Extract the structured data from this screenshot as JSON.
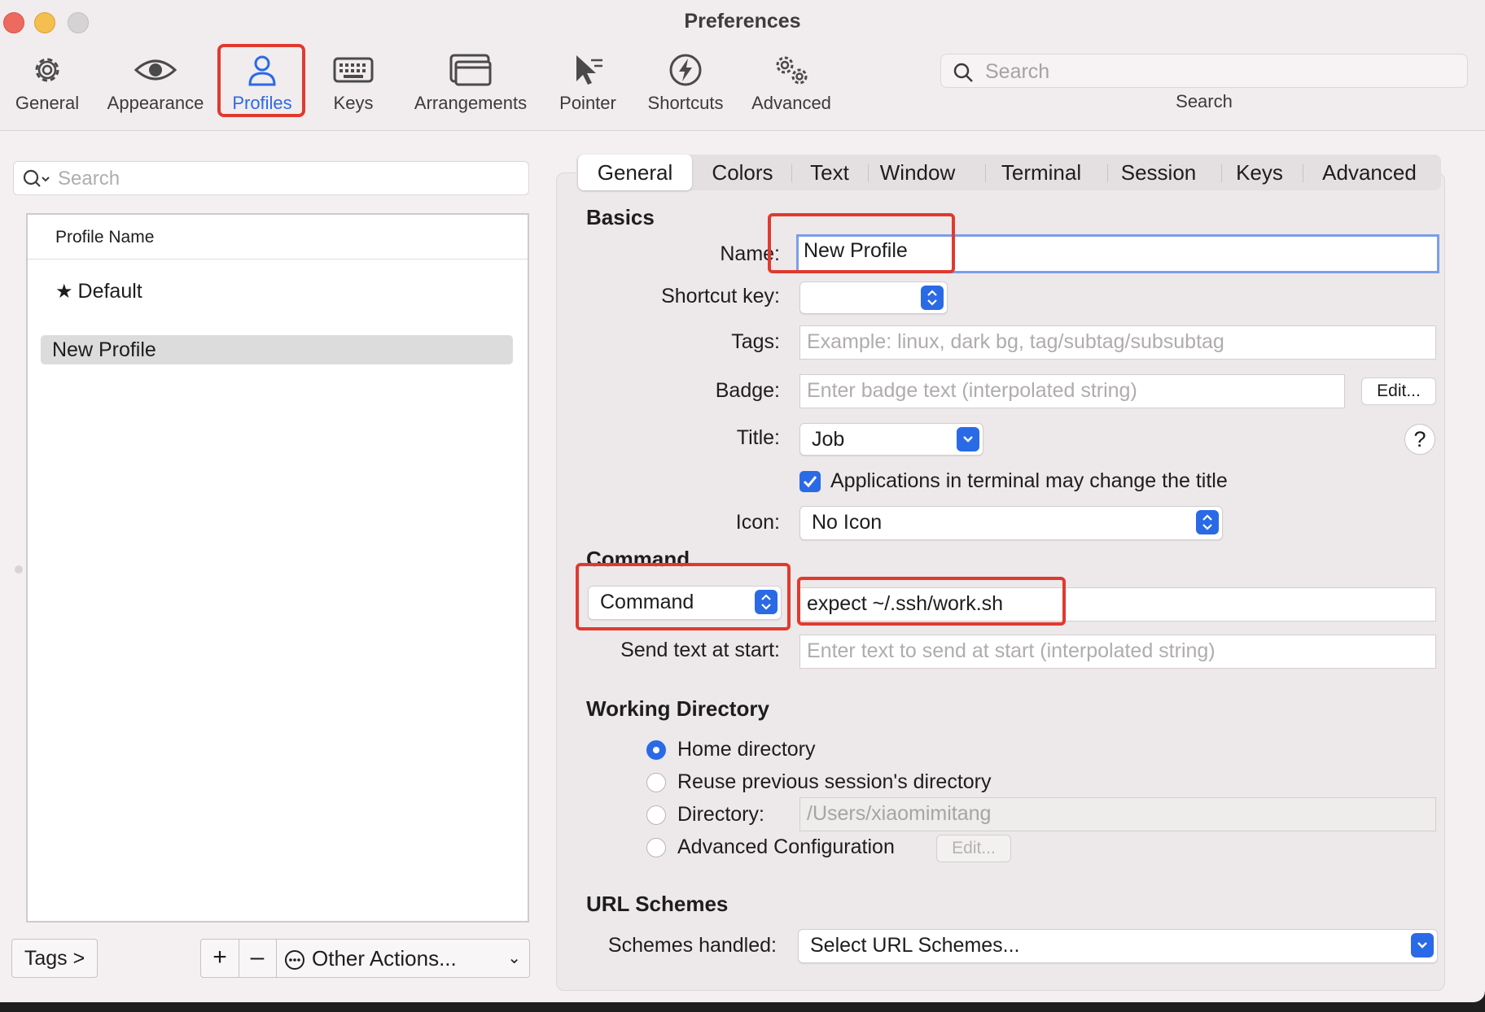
{
  "window": {
    "title": "Preferences"
  },
  "toolbar": {
    "items": [
      {
        "label": "General",
        "icon": "gear-icon"
      },
      {
        "label": "Appearance",
        "icon": "eye-icon"
      },
      {
        "label": "Profiles",
        "icon": "person-icon",
        "active": true
      },
      {
        "label": "Keys",
        "icon": "keyboard-icon"
      },
      {
        "label": "Arrangements",
        "icon": "windows-icon"
      },
      {
        "label": "Pointer",
        "icon": "pointer-icon"
      },
      {
        "label": "Shortcuts",
        "icon": "lightning-icon"
      },
      {
        "label": "Advanced",
        "icon": "gears-icon"
      }
    ],
    "search_placeholder": "Search",
    "search_label": "Search"
  },
  "left_panel": {
    "search_placeholder": "Search",
    "column_header": "Profile Name",
    "profiles": [
      {
        "name": "Default",
        "is_default": true
      },
      {
        "name": "New Profile",
        "selected": true
      }
    ],
    "tags_button": "Tags >",
    "add_button": "+",
    "remove_button": "–",
    "other_actions": "Other Actions..."
  },
  "tabs": [
    "General",
    "Colors",
    "Text",
    "Window",
    "Terminal",
    "Session",
    "Keys",
    "Advanced"
  ],
  "active_tab": "General",
  "basics": {
    "section": "Basics",
    "name_label": "Name:",
    "name_value": "New Profile",
    "shortcut_label": "Shortcut key:",
    "shortcut_value": "",
    "tags_label": "Tags:",
    "tags_placeholder": "Example: linux, dark bg, tag/subtag/subsubtag",
    "badge_label": "Badge:",
    "badge_placeholder": "Enter badge text (interpolated string)",
    "badge_edit": "Edit...",
    "title_label": "Title:",
    "title_value": "Job",
    "help": "?",
    "apps_change_title": "Applications in terminal may change the title",
    "apps_change_title_checked": true,
    "icon_label": "Icon:",
    "icon_value": "No Icon"
  },
  "command": {
    "section": "Command",
    "mode": "Command",
    "value": "expect ~/.ssh/work.sh",
    "send_text_label": "Send text at start:",
    "send_text_placeholder": "Enter text to send at start (interpolated string)"
  },
  "working_directory": {
    "section": "Working Directory",
    "options": [
      "Home directory",
      "Reuse previous session's directory",
      "Directory:",
      "Advanced Configuration"
    ],
    "selected": "Home directory",
    "directory_placeholder": "/Users/xiaomimitang",
    "advanced_edit": "Edit..."
  },
  "url_schemes": {
    "section": "URL Schemes",
    "label": "Schemes handled:",
    "value": "Select URL Schemes..."
  },
  "colors": {
    "accent": "#2a6ae6",
    "highlight_box": "#e03a2f"
  }
}
